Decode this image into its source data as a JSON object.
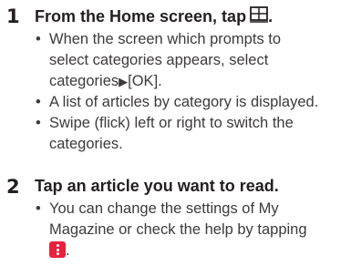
{
  "steps": [
    {
      "number": "1",
      "heading": "From the Home screen, tap",
      "heading_icon": "grid-app-icon",
      "bullets": [
        {
          "lines": [
            "When the screen which prompts to",
            "select categories appears, select"
          ],
          "last_prefix": "categories",
          "last_arrow": "▶",
          "last_suffix": "[OK]."
        },
        {
          "lines": [
            "A list of articles by category is displayed."
          ]
        },
        {
          "lines": [
            "Swipe (flick) left or right to switch the",
            "categories."
          ]
        }
      ]
    },
    {
      "number": "2",
      "heading": "Tap an article you want to read.",
      "bullets": [
        {
          "lines": [
            "You can change the settings of My",
            "Magazine or check the help by tapping"
          ],
          "end_icon": "menu-icon",
          "end_text": "."
        }
      ]
    }
  ],
  "colors": {
    "text": "#231f20",
    "menu_icon": "#e8213d"
  }
}
